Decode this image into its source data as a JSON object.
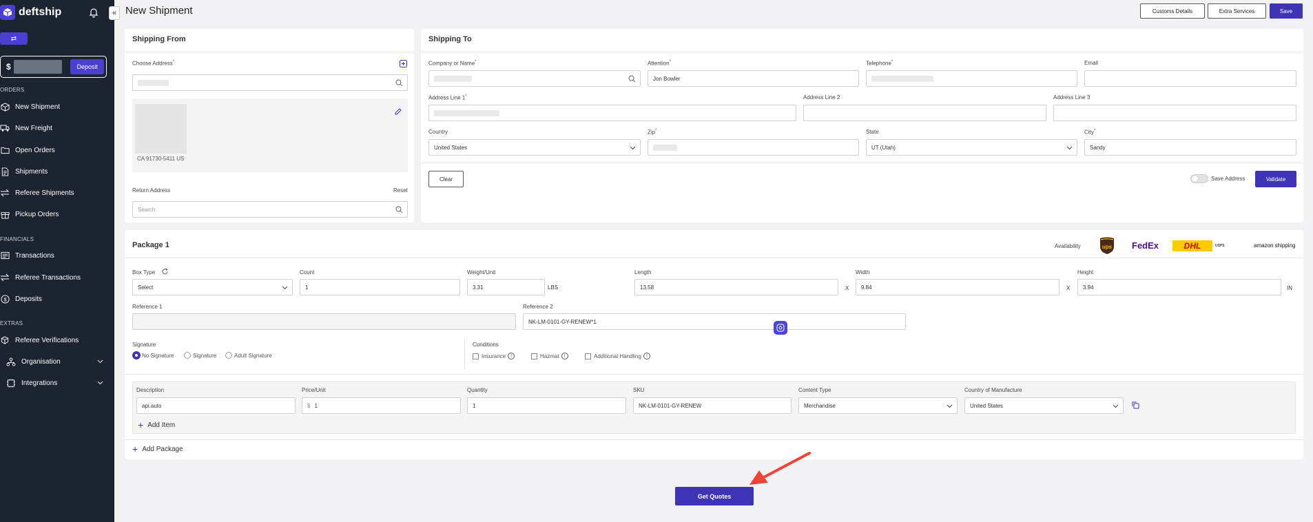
{
  "brand": {
    "name": "deftship",
    "accent": "#3f34b5",
    "sidebar_bg": "#1c2430"
  },
  "sidebar": {
    "balance_currency": "$",
    "deposit_label": "Deposit",
    "sections": {
      "orders": "ORDERS",
      "financials": "FINANCIALS",
      "extras": "EXTRAS"
    },
    "items": [
      {
        "label": "New Shipment",
        "icon": "box-icon"
      },
      {
        "label": "New Freight",
        "icon": "truck-icon"
      },
      {
        "label": "Open Orders",
        "icon": "folder-icon"
      },
      {
        "label": "Shipments",
        "icon": "document-icon"
      },
      {
        "label": "Referee Shipments",
        "icon": "swap-icon"
      },
      {
        "label": "Pickup Orders",
        "icon": "gift-icon"
      },
      {
        "label": "Transactions",
        "icon": "list-icon"
      },
      {
        "label": "Referee Transactions",
        "icon": "swap-icon"
      },
      {
        "label": "Deposits",
        "icon": "dollar-icon"
      },
      {
        "label": "Referee Verifications",
        "icon": "cubes-icon"
      },
      {
        "label": "Organisation",
        "icon": "org-icon"
      },
      {
        "label": "Integrations",
        "icon": "integrations-icon"
      }
    ]
  },
  "header": {
    "title": "New Shipment",
    "customs_label": "Customs Details",
    "extra_label": "Extra Services",
    "save_label": "Save"
  },
  "shipping_from": {
    "title": "Shipping From",
    "choose_label": "Choose Address",
    "address_tail": "CA 91730-5411 US",
    "return_label": "Return Address",
    "reset_label": "Reset",
    "search_placeholder": "Search"
  },
  "shipping_to": {
    "title": "Shipping To",
    "company_label": "Company or Name",
    "attention_label": "Attention",
    "attention_value": "Jon Bowler",
    "telephone_label": "Telephone",
    "email_label": "Email",
    "addr1_label": "Address Line 1",
    "addr2_label": "Address Line 2",
    "addr3_label": "Address Line 3",
    "country_label": "Country",
    "country_value": "United States",
    "zip_label": "Zip",
    "state_label": "State",
    "state_value": "UT (Utah)",
    "city_label": "City",
    "city_value": "Sandy",
    "clear_label": "Clear",
    "save_address_label": "Save Address",
    "validate_label": "Validate"
  },
  "package": {
    "title": "Package 1",
    "availability_label": "Availability",
    "carriers": [
      "ups",
      "FedEx",
      "DHL",
      "USPS",
      "amazon shipping"
    ],
    "box_type_label": "Box Type",
    "box_type_value": "Select",
    "count_label": "Count",
    "count_value": "1",
    "weight_label": "Weight/Unit",
    "weight_value": "3.31",
    "weight_unit": "LBS",
    "length_label": "Length",
    "length_value": "13.58",
    "width_label": "Width",
    "width_value": "9.84",
    "height_label": "Height",
    "height_value": "3.94",
    "dim_x": "X",
    "dim_unit": "IN",
    "ref1_label": "Reference 1",
    "ref2_label": "Reference 2",
    "ref2_value": "NK-LM-0101-GY-RENEW*1",
    "signature_label": "Signature",
    "sig_options": [
      "No Signature",
      "Signature",
      "Adult Signature"
    ],
    "conditions_label": "Conditions",
    "conditions": [
      "Insurance",
      "Hazmat",
      "Additional Handling"
    ],
    "item": {
      "desc_label": "Description",
      "desc_value": "api.auto",
      "price_label": "Price/Unit",
      "price_currency": "$",
      "price_value": "1",
      "qty_label": "Quantity",
      "qty_value": "1",
      "sku_label": "SKU",
      "sku_value": "NK-LM-0101-GY-RENEW",
      "content_label": "Content Type",
      "content_value": "Merchandise",
      "origin_label": "Country of Manufacture",
      "origin_value": "United States"
    },
    "add_item_label": "Add Item",
    "add_package_label": "Add Package"
  },
  "actions": {
    "get_quotes_label": "Get Quotes"
  }
}
